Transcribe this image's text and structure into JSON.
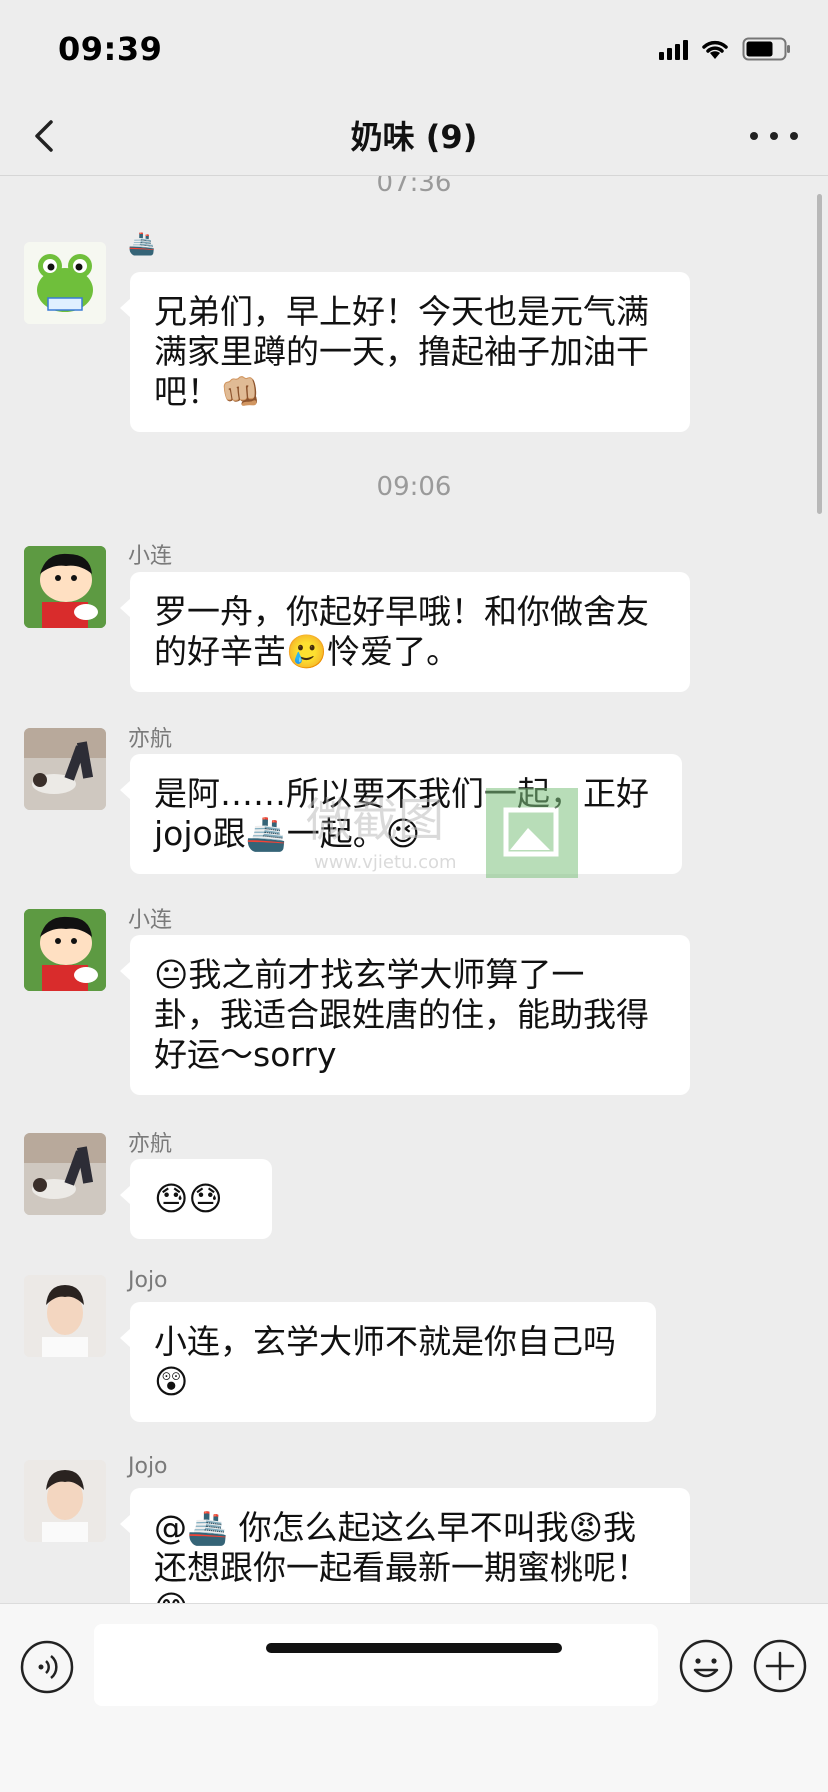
{
  "status_bar": {
    "time": "09:39"
  },
  "header": {
    "title": "奶味 (9)"
  },
  "messages": [
    {
      "timestamp": "07:36"
    },
    {
      "sender": "🚢",
      "text": "兄弟们，早上好！今天也是元气满\n满家里蹲的一天，撸起袖子加油干\n吧！👊🏼"
    },
    {
      "timestamp": "09:06"
    },
    {
      "sender": "小连",
      "text": "罗一舟，你起好早哦！和你做舍友\n的好辛苦🥲怜爱了。"
    },
    {
      "sender": "亦航",
      "text": "是阿……所以要不我们一起，正好\njojo跟🚢一起。😉"
    },
    {
      "sender": "小连",
      "text": "😐我之前才找玄学大师算了一\n卦，我适合跟姓唐的住，能助我得\n好运～sorry"
    },
    {
      "sender": "亦航",
      "text": "😓😓"
    },
    {
      "sender": "Jojo",
      "text": "小连，玄学大师不就是你自己吗\n😲"
    },
    {
      "sender": "Jojo",
      "text": "@🚢 你怎么起这么早不叫我😡我\n还想跟你一起看最新一期蜜桃呢！\n😊"
    }
  ],
  "watermark": {
    "text_cn": "微截图",
    "text_url": "www.vjietu.com"
  },
  "input_bar": {
    "placeholder": ""
  },
  "colors": {
    "background": "#ededed",
    "bubble": "#ffffff",
    "timestamp": "#9a9a9a",
    "sender": "#7a7a7a"
  }
}
